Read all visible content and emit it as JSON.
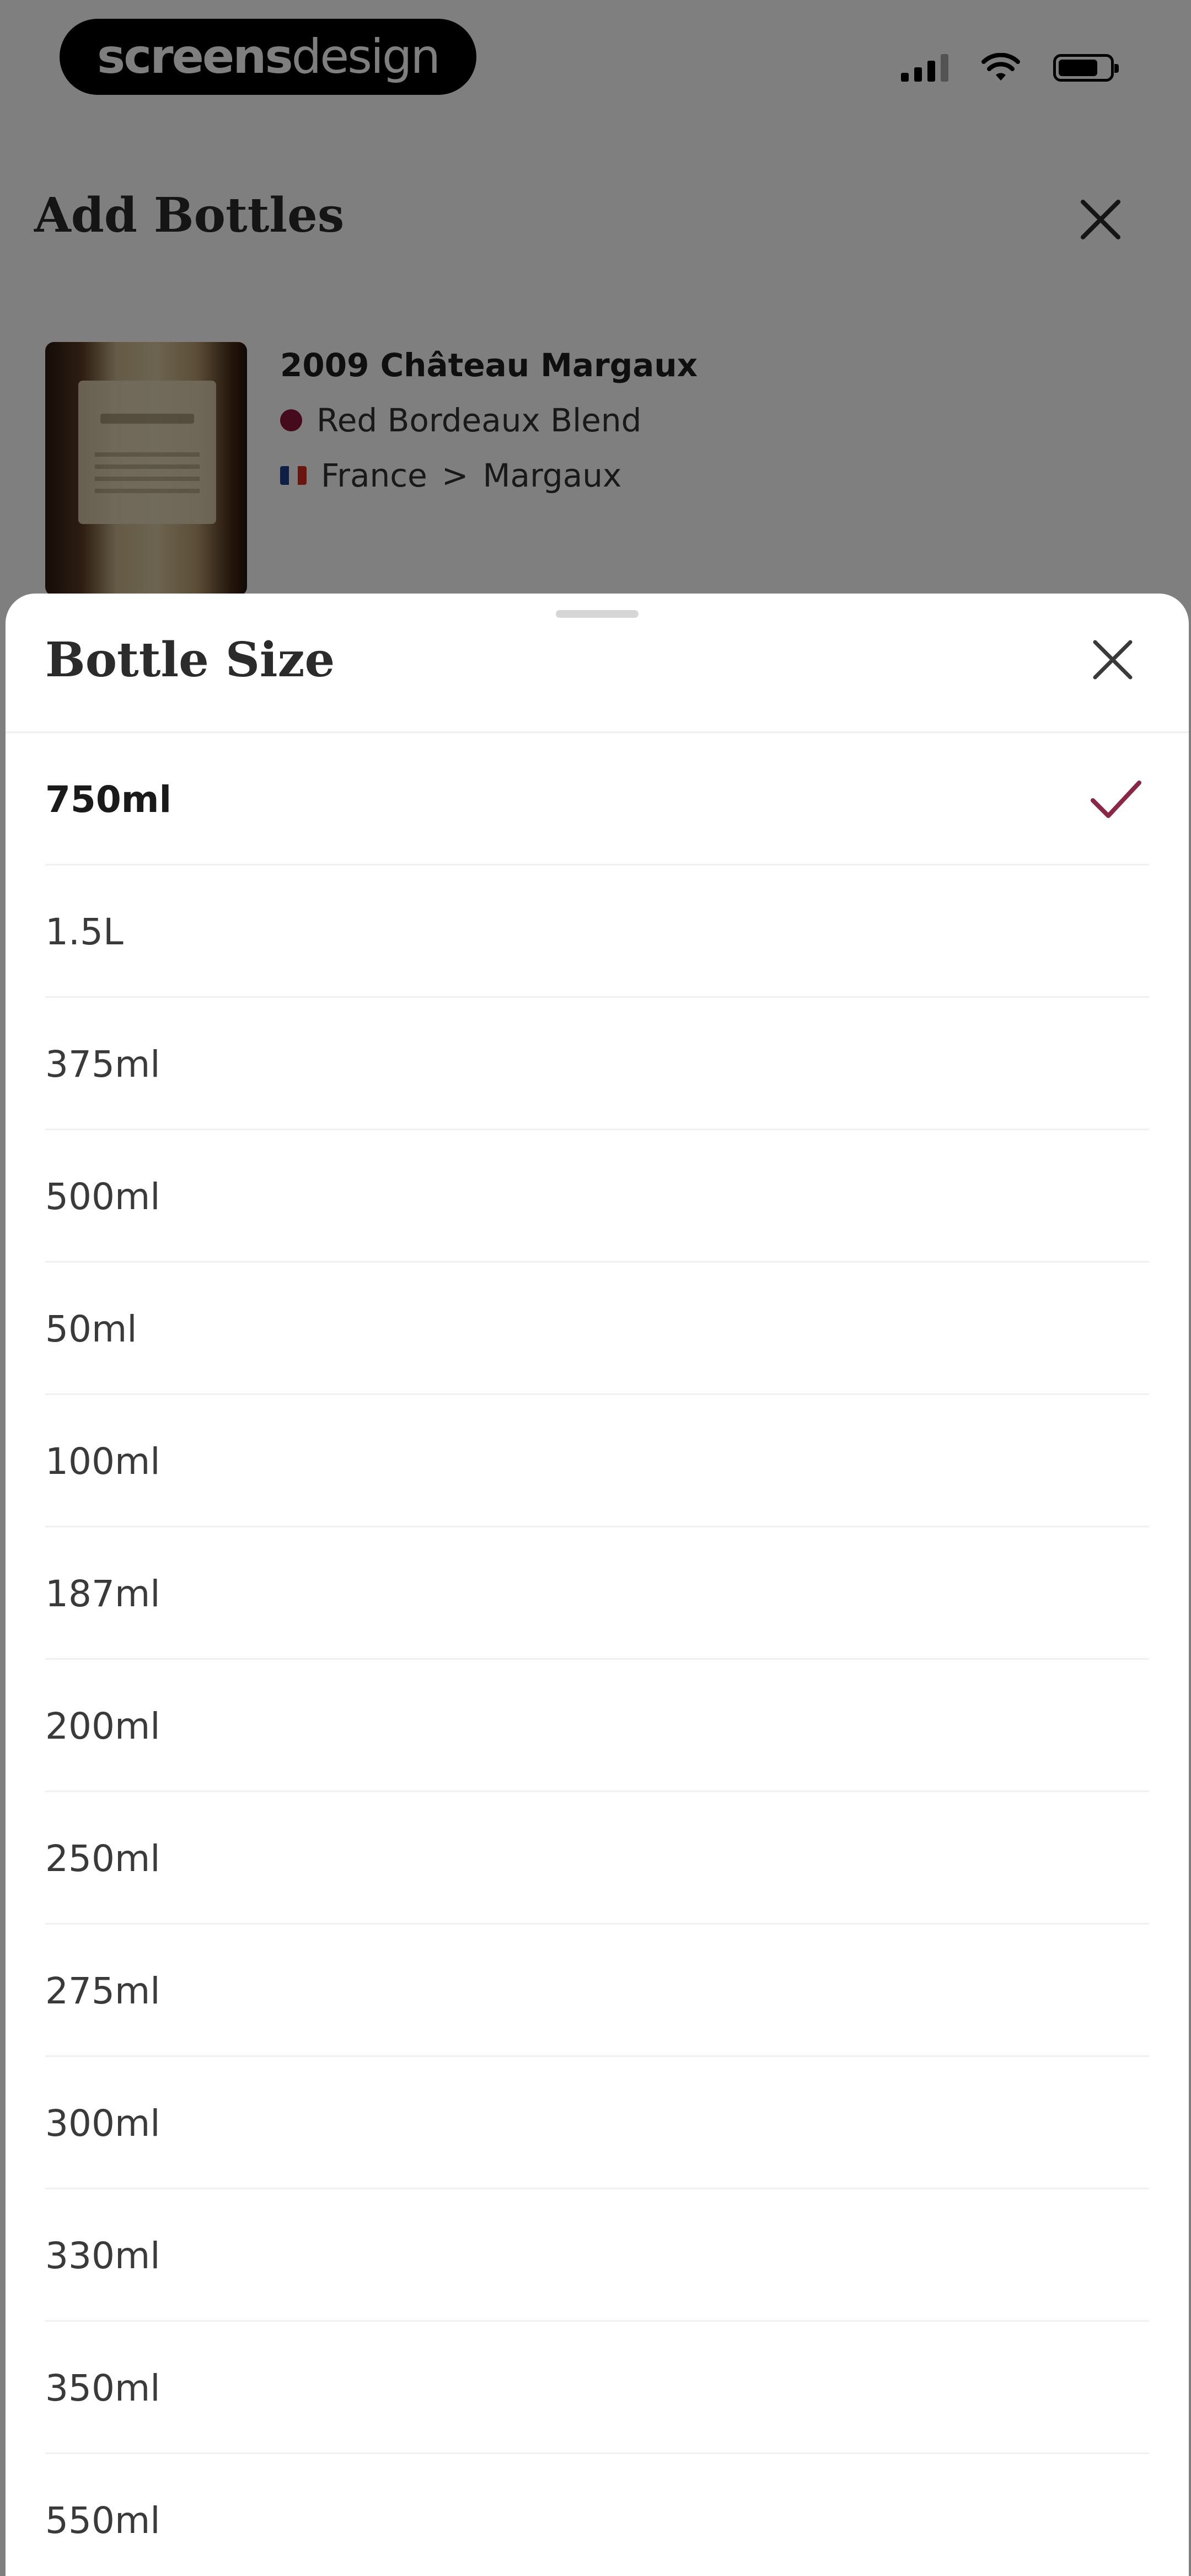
{
  "status_bar": {
    "brand_bold": "screens",
    "brand_light": "design"
  },
  "background": {
    "title": "Add Bottles",
    "wine": {
      "name": "2009 Château Margaux",
      "type": "Red Bordeaux Blend",
      "country": "France",
      "separator": ">",
      "region": "Margaux"
    },
    "icons": [
      "signal-icon",
      "wifi-icon",
      "battery-icon",
      "close-icon",
      "wine-type-dot-icon",
      "france-flag-icon"
    ]
  },
  "sheet": {
    "title": "Bottle Size",
    "selected_index": 0,
    "options": [
      {
        "label": "750ml"
      },
      {
        "label": "1.5L"
      },
      {
        "label": "375ml"
      },
      {
        "label": "500ml"
      },
      {
        "label": "50ml"
      },
      {
        "label": "100ml"
      },
      {
        "label": "187ml"
      },
      {
        "label": "200ml"
      },
      {
        "label": "250ml"
      },
      {
        "label": "275ml"
      },
      {
        "label": "300ml"
      },
      {
        "label": "330ml"
      },
      {
        "label": "350ml"
      },
      {
        "label": "550ml"
      }
    ],
    "icons": [
      "close-icon",
      "checkmark-icon"
    ]
  },
  "colors": {
    "accent_check": "#8a2744",
    "wine_red": "#8a1538",
    "overlay": "rgba(0,0,0,0.5)"
  }
}
